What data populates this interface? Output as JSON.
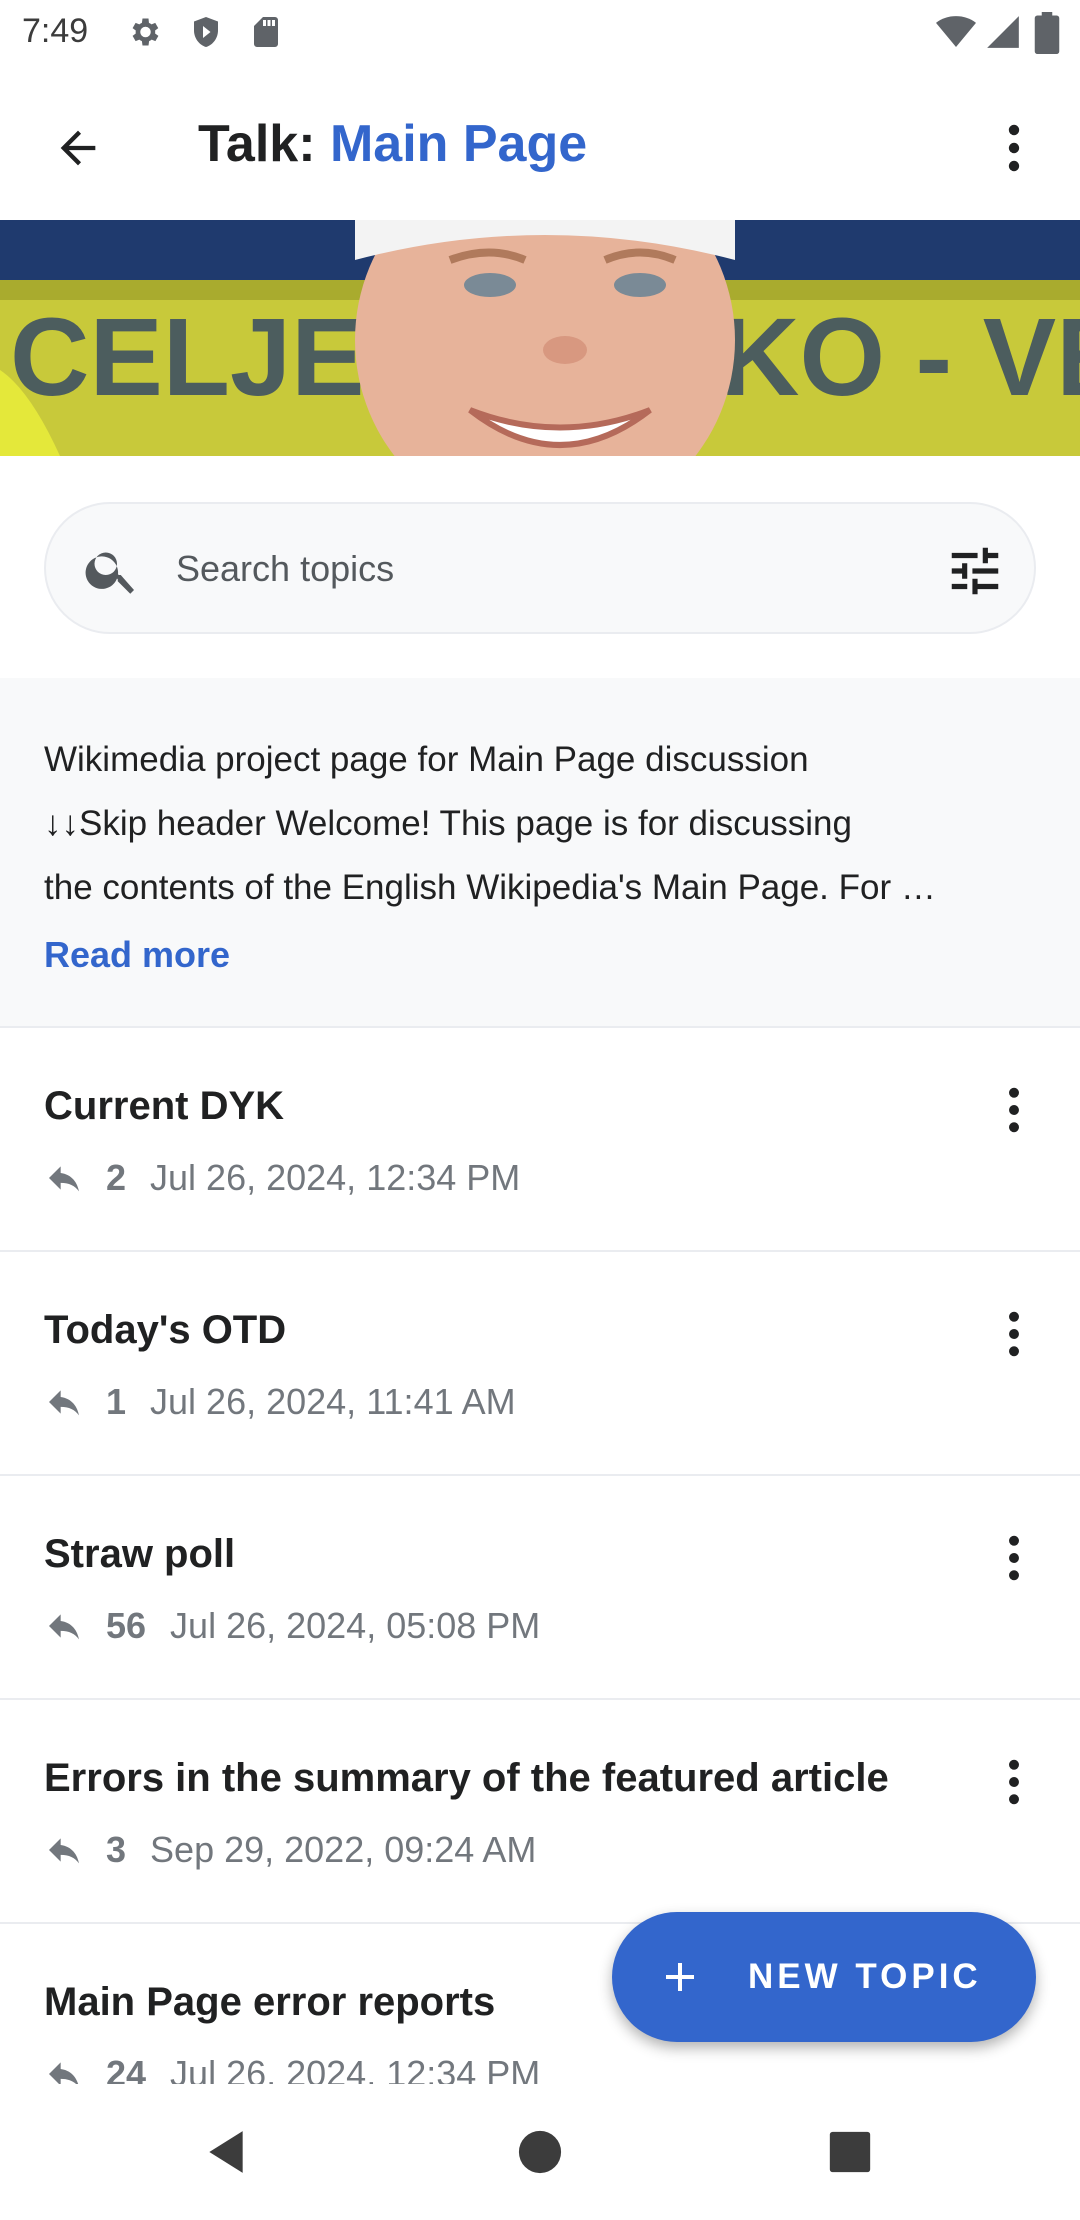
{
  "status_bar": {
    "time": "7:49",
    "left_icons": [
      "settings-icon",
      "shield-icon",
      "sd-card-icon"
    ],
    "right_icons": [
      "wifi-icon",
      "signal-icon",
      "battery-icon"
    ]
  },
  "app_bar": {
    "title_prefix": "Talk: ",
    "title_page": "Main Page",
    "back_icon": "arrow-back-icon",
    "menu_icon": "more-vert-icon"
  },
  "search": {
    "placeholder": "Search topics",
    "icon": "search-icon",
    "filter_icon": "tune-icon"
  },
  "header": {
    "lines": [
      "Wikimedia project page for Main Page discussion",
      "↓↓Skip header   Welcome! This page is for discussing",
      "the contents of the English Wikipedia's Main Page. For …"
    ],
    "read_more": "Read more"
  },
  "topics": [
    {
      "title": "Current DYK",
      "replies": "2",
      "date": "Jul 26, 2024, 12:34 PM"
    },
    {
      "title": "Today's OTD",
      "replies": "1",
      "date": "Jul 26, 2024, 11:41 AM"
    },
    {
      "title": "Straw poll",
      "replies": "56",
      "date": "Jul 26, 2024, 05:08 PM"
    },
    {
      "title": "Errors in the summary of the featured article",
      "replies": "3",
      "date": "Sep 29, 2022, 09:24 AM"
    },
    {
      "title": "Main Page error reports",
      "replies": "24",
      "date": "Jul 26, 2024, 12:34 PM"
    }
  ],
  "fab": {
    "label": "NEW TOPIC",
    "icon": "plus-icon"
  },
  "nav_bar": {
    "icons": [
      "nav-back-icon",
      "nav-home-icon",
      "nav-recents-icon"
    ]
  },
  "colors": {
    "accent": "#3366cc",
    "text": "#202122",
    "secondary_text": "#72777d",
    "header_bg": "#f8f9fa"
  }
}
